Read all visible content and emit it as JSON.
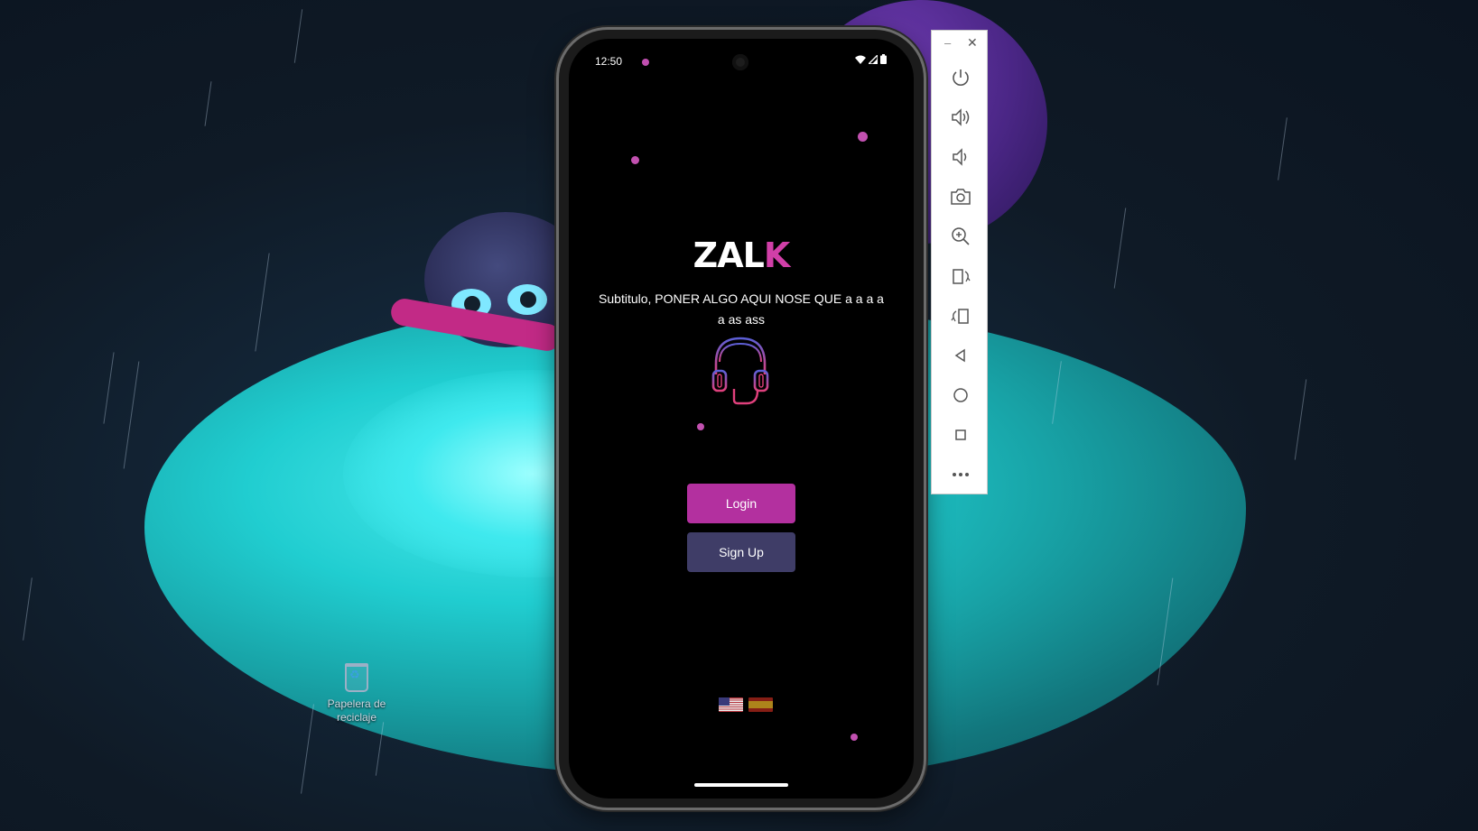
{
  "desktop": {
    "recycle_bin_label": "Papelera de reciclaje"
  },
  "phone": {
    "status_bar": {
      "time": "12:50",
      "icons": [
        "wifi-icon",
        "signal-icon",
        "battery-icon"
      ]
    },
    "app": {
      "logo_main": "ZAL",
      "logo_accent": "K",
      "subtitle": "Subtitulo, PONER ALGO AQUI NOSE QUE a a a a a as ass",
      "login_label": "Login",
      "signup_label": "Sign Up",
      "languages": [
        "us-flag-icon",
        "spain-flag-icon"
      ]
    }
  },
  "emulator_toolbar": {
    "window_controls": [
      "minimize-icon",
      "close-icon"
    ],
    "buttons": [
      "power-icon",
      "volume-up-icon",
      "volume-down-icon",
      "camera-icon",
      "zoom-icon",
      "rotate-left-icon",
      "rotate-right-icon",
      "back-icon",
      "home-icon",
      "overview-icon",
      "more-icon"
    ]
  },
  "colors": {
    "accent": "#d13fa8",
    "login_button": "#b3309f",
    "signup_button": "#3f3d67"
  }
}
